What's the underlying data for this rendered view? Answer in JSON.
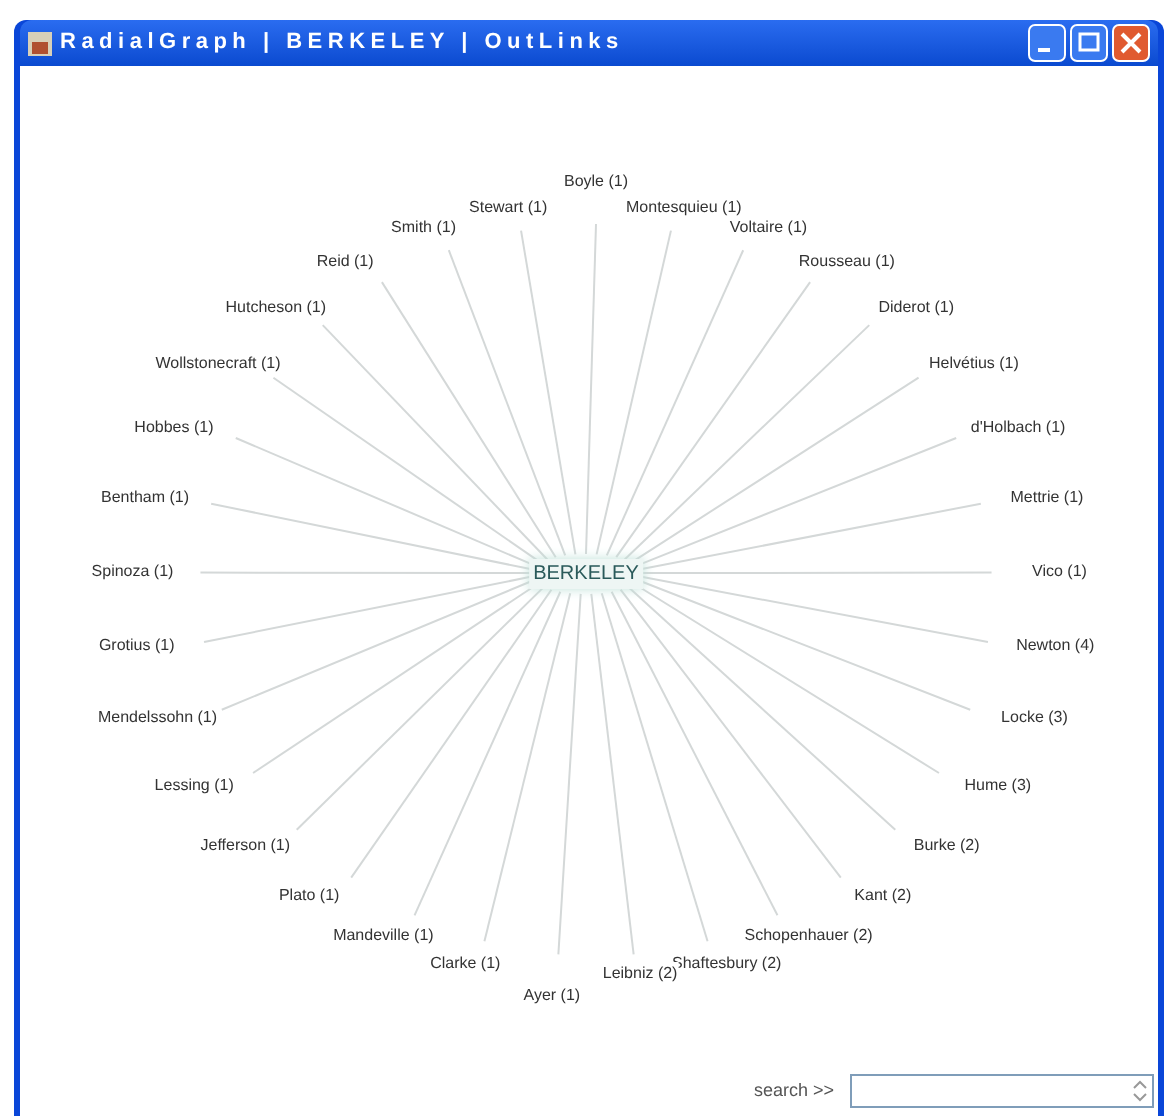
{
  "window": {
    "title": "RadialGraph | BERKELEY | OutLinks"
  },
  "graph": {
    "center": "BERKELEY",
    "right_nodes": [
      "Boyle (1)",
      "Montesquieu (1)",
      "Voltaire (1)",
      "Rousseau (1)",
      "Diderot (1)",
      "Helvétius (1)",
      "d'Holbach (1)",
      "Mettrie (1)",
      "Vico (1)",
      "Newton (4)",
      "Locke (3)",
      "Hume (3)",
      "Burke (2)",
      "Kant (2)",
      "Schopenhauer (2)",
      "Shaftesbury (2)",
      "Leibniz (2)"
    ],
    "left_nodes": [
      "Stewart (1)",
      "Smith (1)",
      "Reid (1)",
      "Hutcheson (1)",
      "Wollstonecraft (1)",
      "Hobbes (1)",
      "Bentham (1)",
      "Spinoza (1)",
      "Grotius (1)",
      "Mendelssohn (1)",
      "Lessing (1)",
      "Jefferson (1)",
      "Plato (1)",
      "Mandeville (1)",
      "Clarke (1)",
      "Ayer (1)"
    ]
  },
  "search": {
    "label": "search >>"
  }
}
